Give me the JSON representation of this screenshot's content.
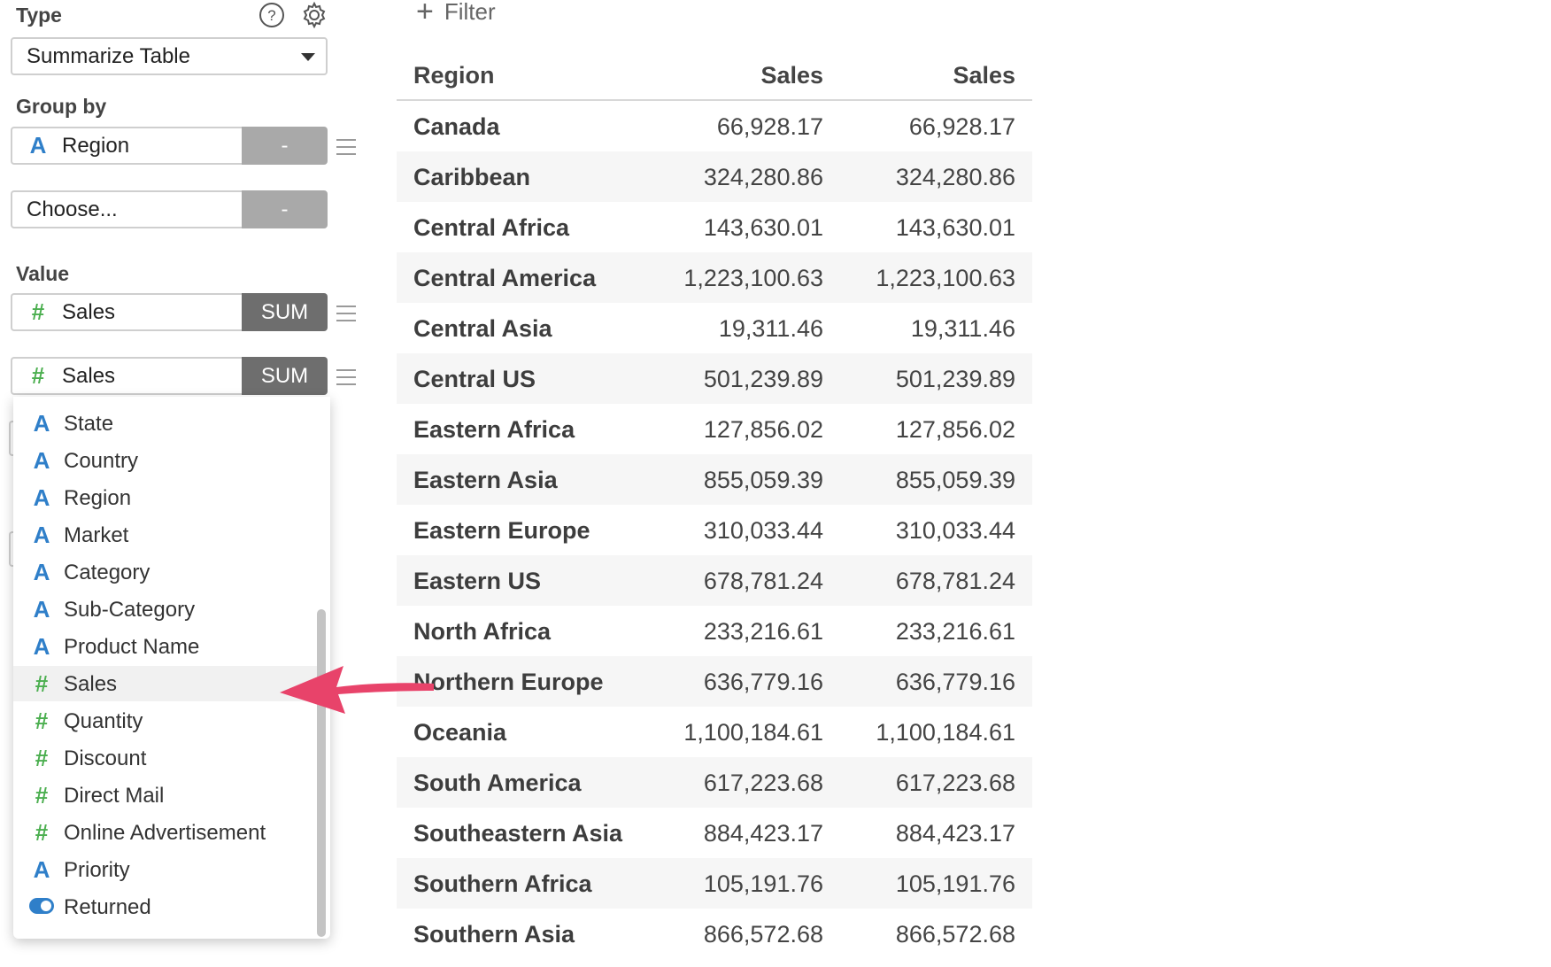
{
  "sidebar": {
    "type_label": "Type",
    "type_select_value": "Summarize Table",
    "group_by_label": "Group by",
    "group_by_field": {
      "glyph": "A",
      "name": "Region",
      "button": "-"
    },
    "group_by_choose": {
      "placeholder": "Choose...",
      "button": "-"
    },
    "value_label": "Value",
    "value_fields": [
      {
        "glyph": "#",
        "name": "Sales",
        "button": "SUM"
      },
      {
        "glyph": "#",
        "name": "Sales",
        "button": "SUM"
      }
    ],
    "icons": {
      "help": "help-icon",
      "settings": "gear-icon",
      "drag": "drag-handle-icon"
    }
  },
  "dropdown": {
    "items": [
      {
        "glyph": "A",
        "kind": "text",
        "label": "State"
      },
      {
        "glyph": "A",
        "kind": "text",
        "label": "Country"
      },
      {
        "glyph": "A",
        "kind": "text",
        "label": "Region"
      },
      {
        "glyph": "A",
        "kind": "text",
        "label": "Market"
      },
      {
        "glyph": "A",
        "kind": "text",
        "label": "Category"
      },
      {
        "glyph": "A",
        "kind": "text",
        "label": "Sub-Category"
      },
      {
        "glyph": "A",
        "kind": "text",
        "label": "Product Name"
      },
      {
        "glyph": "#",
        "kind": "number",
        "label": "Sales",
        "highlighted": true
      },
      {
        "glyph": "#",
        "kind": "number",
        "label": "Quantity"
      },
      {
        "glyph": "#",
        "kind": "number",
        "label": "Discount"
      },
      {
        "glyph": "#",
        "kind": "number",
        "label": "Direct Mail"
      },
      {
        "glyph": "#",
        "kind": "number",
        "label": "Online Advertisement"
      },
      {
        "glyph": "A",
        "kind": "text",
        "label": "Priority"
      },
      {
        "glyph": "",
        "kind": "boolean",
        "label": "Returned"
      }
    ]
  },
  "filter": {
    "label": "Filter"
  },
  "table": {
    "columns": [
      "Region",
      "Sales",
      "Sales"
    ],
    "rows": [
      [
        "Canada",
        "66,928.17",
        "66,928.17"
      ],
      [
        "Caribbean",
        "324,280.86",
        "324,280.86"
      ],
      [
        "Central Africa",
        "143,630.01",
        "143,630.01"
      ],
      [
        "Central America",
        "1,223,100.63",
        "1,223,100.63"
      ],
      [
        "Central Asia",
        "19,311.46",
        "19,311.46"
      ],
      [
        "Central US",
        "501,239.89",
        "501,239.89"
      ],
      [
        "Eastern Africa",
        "127,856.02",
        "127,856.02"
      ],
      [
        "Eastern Asia",
        "855,059.39",
        "855,059.39"
      ],
      [
        "Eastern Europe",
        "310,033.44",
        "310,033.44"
      ],
      [
        "Eastern US",
        "678,781.24",
        "678,781.24"
      ],
      [
        "North Africa",
        "233,216.61",
        "233,216.61"
      ],
      [
        "Northern Europe",
        "636,779.16",
        "636,779.16"
      ],
      [
        "Oceania",
        "1,100,184.61",
        "1,100,184.61"
      ],
      [
        "South America",
        "617,223.68",
        "617,223.68"
      ],
      [
        "Southeastern Asia",
        "884,423.17",
        "884,423.17"
      ],
      [
        "Southern Africa",
        "105,191.76",
        "105,191.76"
      ],
      [
        "Southern Asia",
        "866,572.68",
        "866,572.68"
      ]
    ]
  },
  "colors": {
    "text_type_glyph": "#2f7fc9",
    "number_type_glyph": "#4caf50",
    "agg_button": "#6e6e6e",
    "remove_button": "#a9a9a9",
    "annotation_arrow": "#e8436a"
  }
}
